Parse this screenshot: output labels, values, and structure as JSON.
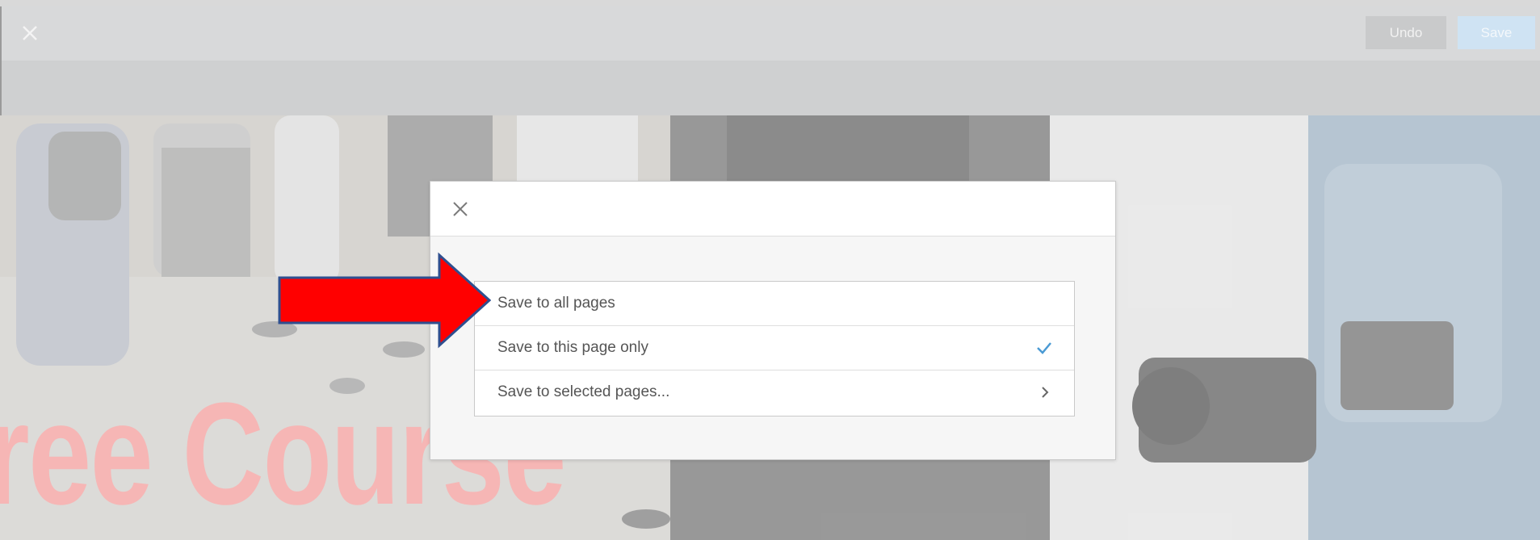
{
  "toolbar": {
    "close_icon": "close-icon",
    "undo_label": "Undo",
    "save_label": "Save"
  },
  "background": {
    "overlay_text": "ree Course"
  },
  "dialog": {
    "close_icon": "close-icon",
    "options": [
      {
        "label": "Save to all pages",
        "selected": false,
        "icon": ""
      },
      {
        "label": "Save to this page only",
        "selected": true,
        "icon": "checkmark-icon"
      },
      {
        "label": "Save to selected pages...",
        "selected": false,
        "icon": "chevron-right-icon"
      }
    ]
  },
  "annotation": {
    "arrow_color": "#ff0000",
    "arrow_outline": "#2f4f8f"
  },
  "colors": {
    "check": "#4a9ad4",
    "save_button_bg": "#cfe3f3"
  }
}
